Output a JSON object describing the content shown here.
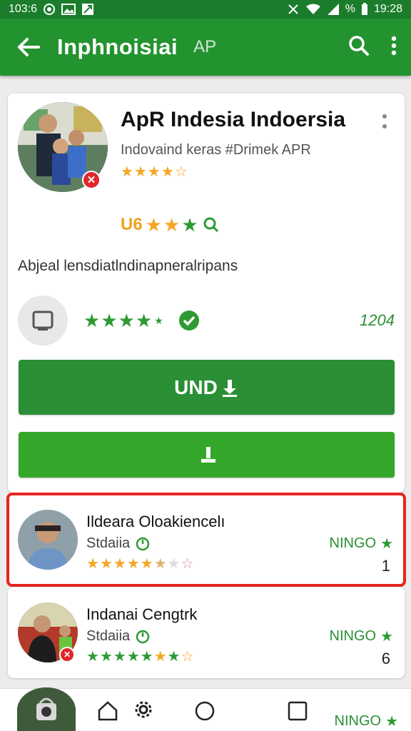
{
  "status_bar": {
    "carrier": "103:6",
    "time": "19:28",
    "battery_text": "%"
  },
  "app_bar": {
    "title": "Inphnoisiai",
    "subtitle": "AP"
  },
  "app": {
    "title": "ApR Indesia Indoersia",
    "developer": "Indovaind keras #Drimek APR",
    "rating": 4,
    "age_code": "U6",
    "description": "Abjeal lensdiatlndinapneralripans",
    "stats_rating": 4,
    "download_count": "1204",
    "install_label": "UND",
    "download_label": ""
  },
  "list_items": [
    {
      "title": "Ildeara Oloakiencelı",
      "subtitle": "Stdaiia",
      "tag": "NINGO",
      "count": "1",
      "rating": 4.5,
      "highlighted": true
    },
    {
      "title": "Indanai Cengtrk",
      "subtitle": "Stdaiia",
      "tag": "NINGO",
      "count": "6",
      "rating": 6,
      "highlighted": false
    }
  ],
  "bottom_nav": {
    "tag": "NINGO"
  },
  "colors": {
    "primary": "#23932f",
    "primary_dark": "#1b7d2c",
    "accent_green": "#2a8f35",
    "star_yellow": "#f5a623",
    "star_green": "#2d9a33",
    "highlight_red": "#e52420"
  }
}
